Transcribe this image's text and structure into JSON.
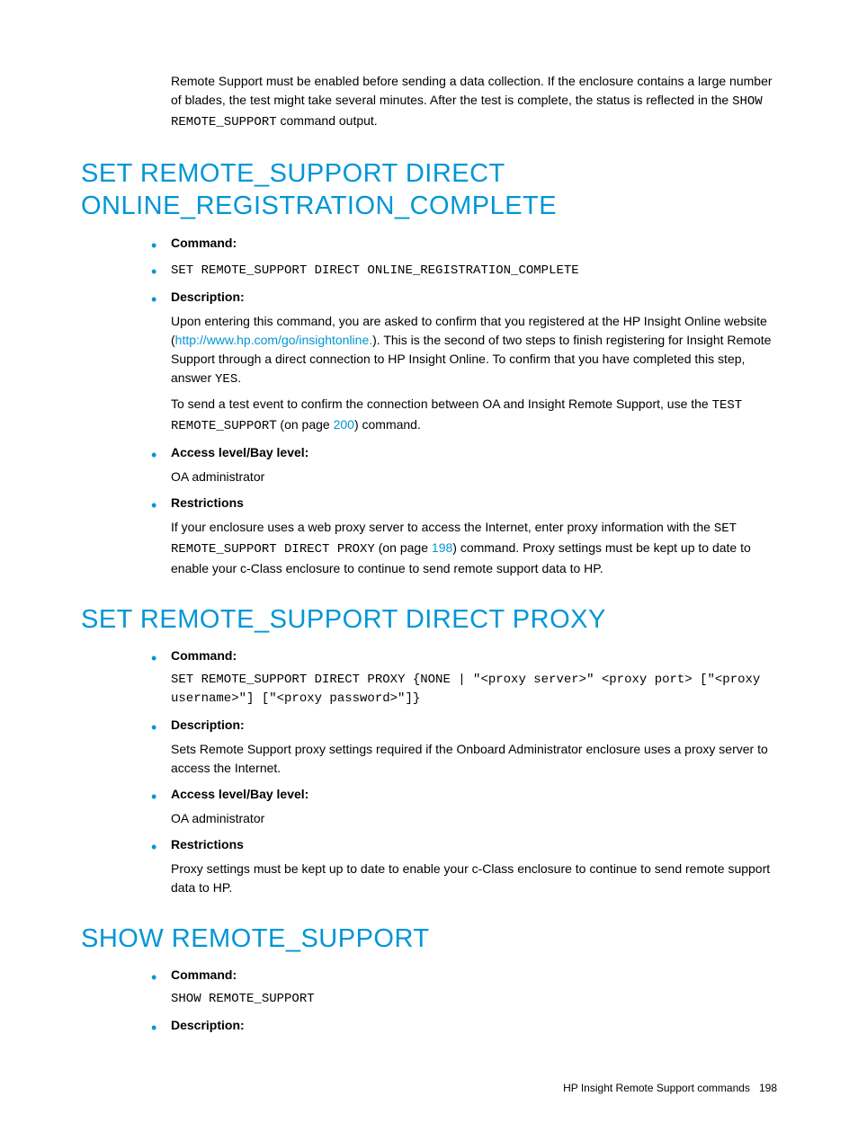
{
  "intro": {
    "p1a": "Remote Support must be enabled before sending a data collection. If the enclosure contains a large number of blades, the test might take several minutes. After the test is complete, the status is reflected in the ",
    "p1code": "SHOW REMOTE_SUPPORT",
    "p1b": " command output."
  },
  "sec1": {
    "heading": "SET REMOTE_SUPPORT DIRECT ONLINE_REGISTRATION_COMPLETE",
    "command_label": "Command:",
    "command_text": "SET REMOTE_SUPPORT DIRECT ONLINE_REGISTRATION_COMPLETE",
    "desc_label": "Description:",
    "desc_p1a": "Upon entering this command, you are asked to confirm that you registered at the HP Insight Online website (",
    "desc_link1": "http://www.hp.com/go/insightonline.",
    "desc_p1b": "). This is the second of two steps to finish registering for Insight Remote Support through a direct connection to HP Insight Online. To confirm that you have completed this step, answer ",
    "desc_code1": "YES",
    "desc_p1c": ".",
    "desc_p2a": "To send a test event to confirm the connection between OA and Insight Remote Support, use the ",
    "desc_code2": "TEST REMOTE_SUPPOR",
    "desc_p2b": "T (on page ",
    "desc_link2": "200",
    "desc_p2c": ") command.",
    "access_label": "Access level/Bay level:",
    "access_text": "OA administrator",
    "restr_label": "Restrictions",
    "restr_p1a": "If your enclosure uses a web proxy server to access the Internet, enter proxy information with the ",
    "restr_code": "SET REMOTE_SUPPORT DIRECT PROXY",
    "restr_p1b": " (on page ",
    "restr_link": "198",
    "restr_p1c": ") command. Proxy settings must be kept up to date to enable your c-Class enclosure to continue to send remote support data to HP."
  },
  "sec2": {
    "heading": "SET REMOTE_SUPPORT DIRECT PROXY",
    "command_label": "Command:",
    "command_text": "SET REMOTE_SUPPORT DIRECT PROXY {NONE | \"<proxy server>\" <proxy port> [\"<proxy username>\"] [\"<proxy password>\"]}",
    "desc_label": "Description:",
    "desc_text": "Sets Remote Support proxy settings required if the Onboard Administrator enclosure uses a proxy server to access the Internet.",
    "access_label": "Access level/Bay level:",
    "access_text": "OA administrator",
    "restr_label": "Restrictions",
    "restr_text": "Proxy settings must be kept up to date to enable your c-Class enclosure to continue to send remote support data to HP."
  },
  "sec3": {
    "heading": "SHOW REMOTE_SUPPORT",
    "command_label": "Command:",
    "command_text": "SHOW REMOTE_SUPPORT",
    "desc_label": "Description:"
  },
  "footer": {
    "text": "HP Insight Remote Support commands",
    "page": "198"
  }
}
